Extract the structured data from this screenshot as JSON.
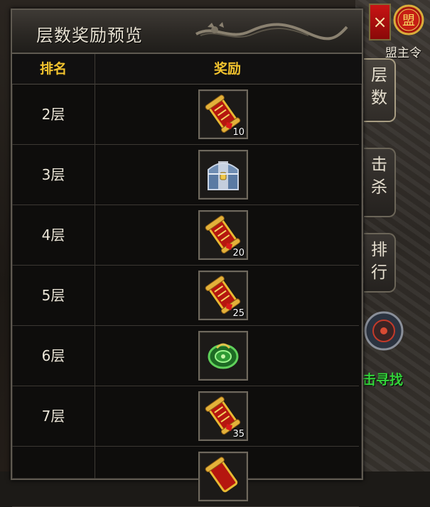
{
  "panel": {
    "title": "层数奖励预览",
    "columns": {
      "rank": "排名",
      "reward": "奖励"
    },
    "rows": [
      {
        "floor": "2层",
        "item_icon": "red-scroll-icon",
        "qty": "10"
      },
      {
        "floor": "3层",
        "item_icon": "treasure-chest-icon",
        "qty": ""
      },
      {
        "floor": "4层",
        "item_icon": "red-scroll-icon",
        "qty": "20"
      },
      {
        "floor": "5层",
        "item_icon": "red-scroll-icon",
        "qty": "25"
      },
      {
        "floor": "6层",
        "item_icon": "jade-pendant-icon",
        "qty": ""
      },
      {
        "floor": "7层",
        "item_icon": "red-scroll-icon",
        "qty": "35"
      },
      {
        "floor": "",
        "item_icon": "red-scroll-icon",
        "qty": ""
      }
    ]
  },
  "close_label": "×",
  "badge": {
    "glyph": "盟",
    "label": "盟主令"
  },
  "side_tabs": {
    "layers": "层数",
    "kill": "击杀",
    "rank": "排行"
  },
  "find_label": "击寻找",
  "colors": {
    "header_text": "#f2c32e",
    "close_bg": "#c81414",
    "find_text": "#33d33a"
  }
}
